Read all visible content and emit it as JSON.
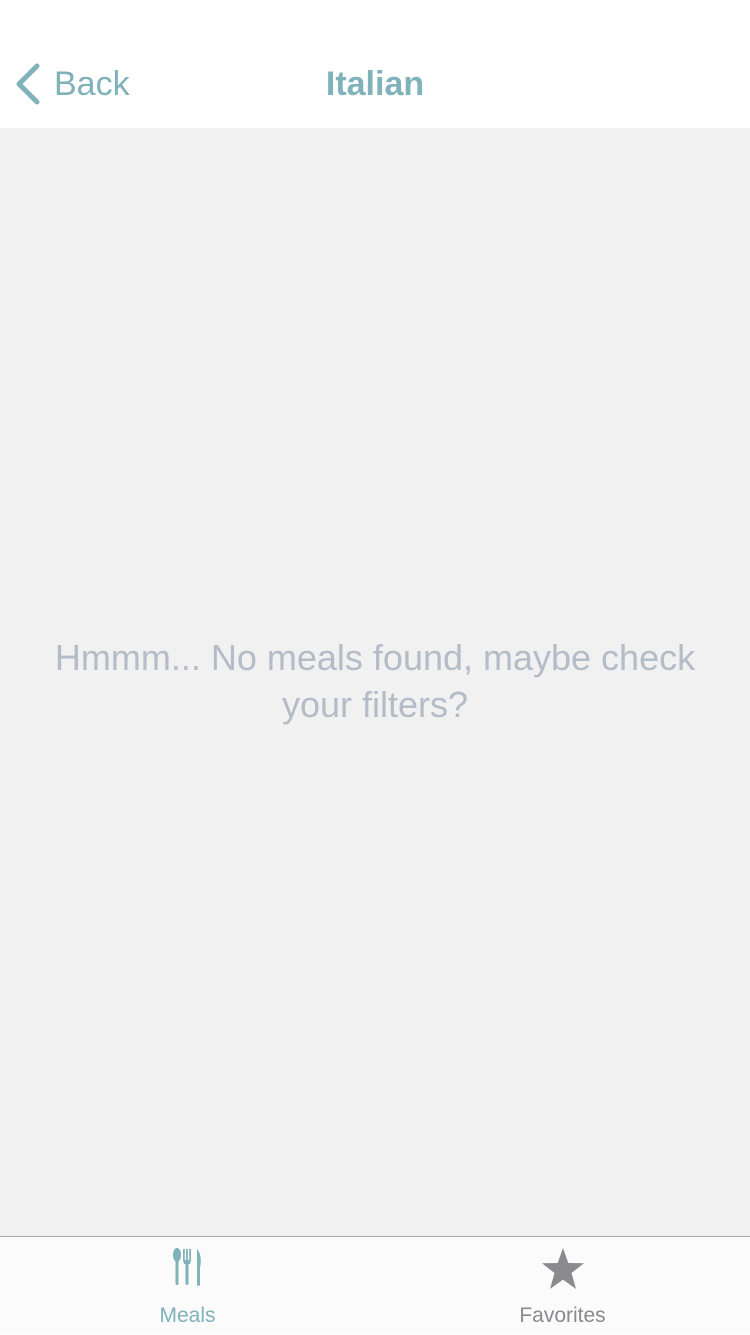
{
  "nav": {
    "back_label": "Back",
    "title": "Italian"
  },
  "content": {
    "empty_message": "Hmmm... No meals found, maybe check your filters?"
  },
  "tabs": [
    {
      "label": "Meals",
      "icon": "fork-knife-icon",
      "active": true
    },
    {
      "label": "Favorites",
      "icon": "star-icon",
      "active": false
    }
  ],
  "colors": {
    "accent": "#7fb2b9",
    "inactive": "#8a8a8f",
    "background": "#f1f1f1",
    "message": "#b3bcc7"
  }
}
